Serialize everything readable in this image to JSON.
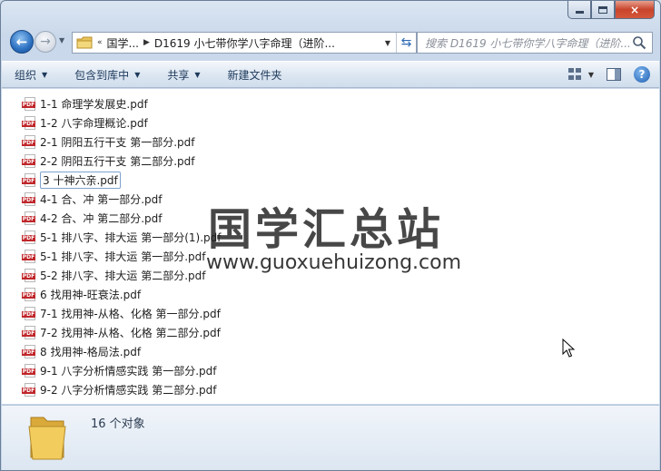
{
  "window": {
    "caption": {
      "close_glyph": "×"
    }
  },
  "nav": {
    "address_prefix": "«",
    "crumbs": [
      "国学...",
      "D1619 小七带你学八字命理（进阶..."
    ],
    "search_placeholder": "搜索 D1619 小七带你学八字命理（进阶..."
  },
  "commands": [
    {
      "label": "组织"
    },
    {
      "label": "包含到库中"
    },
    {
      "label": "共享"
    },
    {
      "label": "新建文件夹"
    }
  ],
  "files": [
    {
      "name": "1-1 命理学发展史.pdf"
    },
    {
      "name": "1-2 八字命理概论.pdf"
    },
    {
      "name": "2-1 阴阳五行干支 第一部分.pdf"
    },
    {
      "name": "2-2 阴阳五行干支 第二部分.pdf"
    },
    {
      "name": "3 十神六亲.pdf"
    },
    {
      "name": "4-1 合、冲 第一部分.pdf"
    },
    {
      "name": "4-2 合、冲 第二部分.pdf"
    },
    {
      "name": "5-1 排八字、排大运 第一部分(1).pdf"
    },
    {
      "name": "5-1 排八字、排大运 第一部分.pdf"
    },
    {
      "name": "5-2 排八字、排大运 第二部分.pdf"
    },
    {
      "name": "6 找用神-旺衰法.pdf"
    },
    {
      "name": "7-1 找用神-从格、化格 第一部分.pdf"
    },
    {
      "name": "7-2 找用神-从格、化格 第二部分.pdf"
    },
    {
      "name": "8 找用神-格局法.pdf"
    },
    {
      "name": "9-1 八字分析情感实践 第一部分.pdf"
    },
    {
      "name": "9-2 八字分析情感实践 第二部分.pdf"
    }
  ],
  "file_icon_label": "PDF",
  "watermark": {
    "title": "国学汇总站",
    "url": "www.guoxuehuizong.com"
  },
  "details": {
    "count_text": "16 个对象"
  },
  "colors": {
    "accent": "#2a6fc0",
    "pdf_red": "#c0262a",
    "close_red": "#c8452c"
  }
}
